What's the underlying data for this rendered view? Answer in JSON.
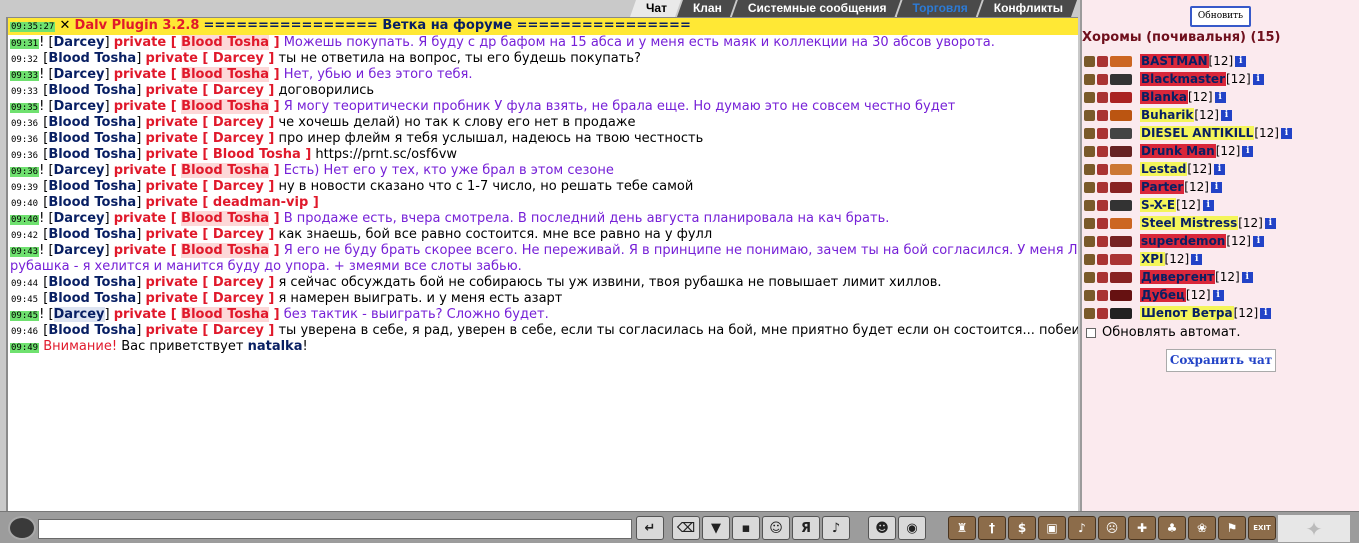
{
  "tabs": [
    {
      "label": "Чат"
    },
    {
      "label": "Клан"
    },
    {
      "label": "Системные сообщения"
    },
    {
      "label": "Торговля"
    },
    {
      "label": "Конфликты"
    }
  ],
  "chat": {
    "header": {
      "time": "09:35:27",
      "title": "Dalv Plugin 3.2.8",
      "text": "================ Ветка на форуме ================"
    },
    "lines": [
      {
        "time": "09:31",
        "from": "Darcey",
        "to": "Blood Tosha",
        "text": "Можешь покупать. Я буду с др бафом на 15 абса и у меня есть маяк и коллекции на 30 абсов уворота.",
        "pv": true
      },
      {
        "time": "09:32",
        "from": "Blood Tosha",
        "to": "Darcey",
        "text": "ты не ответила на вопрос, ты его будешь покупать?",
        "pv": false
      },
      {
        "time": "09:33",
        "from": "Darcey",
        "to": "Blood Tosha",
        "text": "Нет, убью и без этого тебя.",
        "pv": true
      },
      {
        "time": "09:33",
        "from": "Blood Tosha",
        "to": "Darcey",
        "text": "договорились",
        "pv": false
      },
      {
        "time": "09:35",
        "from": "Darcey",
        "to": "Blood Tosha",
        "text": "Я могу теоритически пробник У фула взять, не брала еще. Но думаю это не совсем честно будет",
        "pv": true
      },
      {
        "time": "09:36",
        "from": "Blood Tosha",
        "to": "Darcey",
        "text": "че хочешь делай) но так к слову его нет в продаже",
        "pv": false
      },
      {
        "time": "09:36",
        "from": "Blood Tosha",
        "to": "Darcey",
        "text": "про инер флейм я тебя услышал, надеюсь на твою честность",
        "pv": false
      },
      {
        "time": "09:36",
        "from": "Blood Tosha",
        "to": "Blood Tosha",
        "text": "https://prnt.sc/osf6vw",
        "pv": false
      },
      {
        "time": "09:36",
        "from": "Darcey",
        "to": "Blood Tosha",
        "text": "Есть) Нет его у тех, кто уже брал в этом сезоне",
        "pv": true
      },
      {
        "time": "09:39",
        "from": "Blood Tosha",
        "to": "Darcey",
        "text": "ну в новости сказано что с 1-7 число, но решать тебе самой",
        "pv": false
      },
      {
        "time": "09:40",
        "from": "Blood Tosha",
        "to": "deadman-vip",
        "text": "",
        "pv": false
      },
      {
        "time": "09:40",
        "from": "Darcey",
        "to": "Blood Tosha",
        "text": "В продаже есть, вчера смотрела. В последний день августа планировала на кач брать.",
        "pv": true
      },
      {
        "time": "09:42",
        "from": "Blood Tosha",
        "to": "Darcey",
        "text": "как знаешь, бой все равно состоится. мне все равно на у фулл",
        "pv": false
      },
      {
        "time": "09:43",
        "from": "Darcey",
        "to": "Blood Tosha",
        "text": "Я его не буду брать скорее всего. Не переживай. Я в принципе не понимаю, зачем ты на бой согласился. У меня Л рубашка - я хелится и манится буду до упора. + змеями все слоты забью.",
        "pv": true
      },
      {
        "time": "09:44",
        "from": "Blood Tosha",
        "to": "Darcey",
        "text": "я сейчас обсуждать бой не собираюсь ты уж извини, твоя рубашка не повышает лимит хиллов.",
        "pv": false
      },
      {
        "time": "09:45",
        "from": "Blood Tosha",
        "to": "Darcey",
        "text": "я намерен выиграть. и у меня есть азарт",
        "pv": false
      },
      {
        "time": "09:45",
        "from": "Darcey",
        "to": "Blood Tosha",
        "text": "без тактик - выиграть? Сложно будет.",
        "pv": true
      },
      {
        "time": "09:46",
        "from": "Blood Tosha",
        "to": "Darcey",
        "text": "ты уверена в себе, я рад, уверен в себе, если ты согласилась на бой, мне приятно будет если он состоится... побеит сильнейший)",
        "pv": false
      }
    ],
    "system": {
      "time": "09:49",
      "warn": "Внимание!",
      "text": "Вас приветствует",
      "nick": "natalka"
    }
  },
  "right_panel": {
    "refresh_label": "Обновить",
    "room_title": "Хоромы (почивальня) (15)",
    "users": [
      {
        "name": "BASTMAN",
        "level": "[12]",
        "style": "red"
      },
      {
        "name": "Blackmaster",
        "level": "[12]",
        "style": "red"
      },
      {
        "name": "Blanka",
        "level": "[12]",
        "style": "red"
      },
      {
        "name": "Buharik",
        "level": "[12]",
        "style": "yel"
      },
      {
        "name": "DIESEL ANTIKILL",
        "level": "[12]",
        "style": "yel"
      },
      {
        "name": "Drunk Man",
        "level": "[12]",
        "style": "red"
      },
      {
        "name": "Lestad",
        "level": "[12]",
        "style": "yel"
      },
      {
        "name": "Parter",
        "level": "[12]",
        "style": "red"
      },
      {
        "name": "S-X-E",
        "level": "[12]",
        "style": "yel"
      },
      {
        "name": "Steel Mistress",
        "level": "[12]",
        "style": "yel"
      },
      {
        "name": "superdemon",
        "level": "[12]",
        "style": "red"
      },
      {
        "name": "XPI",
        "level": "[12]",
        "style": "yel"
      },
      {
        "name": "Дивергент",
        "level": "[12]",
        "style": "red"
      },
      {
        "name": "Дубец",
        "level": "[12]",
        "style": "red"
      },
      {
        "name": "Шепот Ветра",
        "level": "[12]",
        "style": "yel"
      }
    ],
    "auto_refresh_label": "Обновлять автомат.",
    "save_chat_label": "Сохранить чат"
  },
  "toolbar": {
    "exit_label": "EXIT"
  }
}
